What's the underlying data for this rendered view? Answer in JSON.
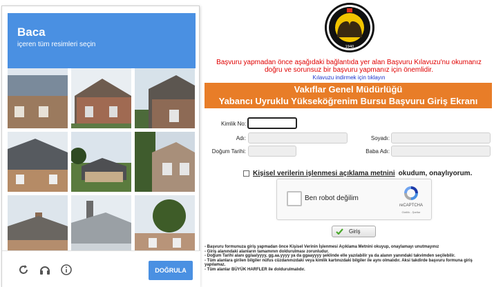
{
  "page": {
    "top_red_text": "...",
    "notice": "Başvuru yapmadan önce aşağıdaki bağlantıda yer alan Başvuru Kılavuzu'nu okumanız doğru ve sorunsuz bir başvuru yapmanız için önemlidir.",
    "guide_link": "Kılavuzu indirmek için tıklayın",
    "banner_line1": "Vakıflar Genel Müdürlüğü",
    "banner_line2": "Yabancı Uyruklu Yükseköğrenim Bursu Başvuru Giriş Ekranı",
    "logo_text": "T.C. VAKIFLAR GENEL MÜDÜRLÜĞÜ",
    "logo_year": "1940",
    "fields": {
      "kimlik_label": "Kimlik No:",
      "ad_label": "Adı:",
      "soyad_label": "Soyadı:",
      "dogum_label": "Doğum Tarihi:",
      "baba_label": "Baba Adı:"
    },
    "consent_link": "Kişisel verilerin işlenmesi açıklama metnini",
    "consent_rest": "okudum, onaylıyorum.",
    "recaptcha": {
      "label": "Ben robot değilim",
      "brand": "reCAPTCHA",
      "terms": "Gizlilik - Şartlar"
    },
    "submit_label": "Giriş",
    "rules": [
      "- Başvuru formunuza giriş yapmadan önce Kişisel Verinin İşlenmesi Açıklama Metnini okuyup, onaylamayı unutmayınız",
      "- Giriş alanındaki alanların tamamının doldurulması zorunludur.",
      "- Doğum Tarihi alanı gg/aa/yyyy, gg.aa.yyyy ya da ggaayyyy şeklinde elle yazılabilir ya da alanın yanındaki takvimden seçilebilir.",
      "- Tüm alanlara girilen bilgiler nüfus cüzdanınızdaki veya kimlik kartınızdaki bilgiler ile aynı olmalıdır. Aksi takdirde başvuru formuna giriş yapılamaz.",
      "- Tüm alanlar BÜYÜK HARFLER ile doldurulmalıdır."
    ]
  },
  "challenge": {
    "title": "Baca",
    "subtitle": "içeren tüm resimleri seçin",
    "verify_label": "DOĞRULA",
    "footer_icons": [
      "reload-icon",
      "audio-icon",
      "info-icon"
    ],
    "accent": "#4a90e2"
  },
  "colors": {
    "banner": "#e87d28",
    "notice": "#e00000",
    "link": "#1a33cc"
  }
}
